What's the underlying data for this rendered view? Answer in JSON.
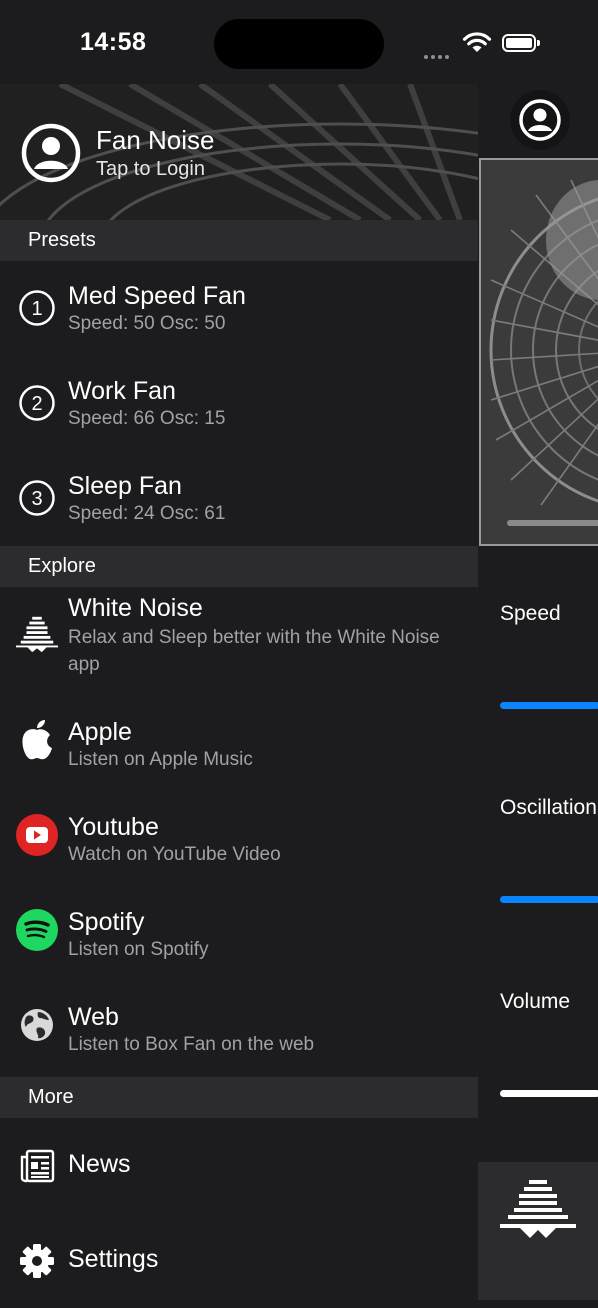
{
  "status": {
    "time": "14:58"
  },
  "header": {
    "title": "Fan Noise",
    "subtitle": "Tap to Login"
  },
  "sections": {
    "presets": "Presets",
    "explore": "Explore",
    "more": "More"
  },
  "presets": [
    {
      "number": "1",
      "title": "Med Speed Fan",
      "subtitle": "Speed: 50 Osc: 50"
    },
    {
      "number": "2",
      "title": "Work Fan",
      "subtitle": "Speed: 66 Osc: 15"
    },
    {
      "number": "3",
      "title": "Sleep Fan",
      "subtitle": "Speed: 24 Osc: 61"
    }
  ],
  "explore": [
    {
      "icon": "white-noise-icon",
      "title": "White Noise",
      "subtitle": "Relax and Sleep better with the White Noise app"
    },
    {
      "icon": "apple-icon",
      "title": "Apple",
      "subtitle": "Listen on Apple Music"
    },
    {
      "icon": "youtube-icon",
      "title": "Youtube",
      "subtitle": "Watch on YouTube Video"
    },
    {
      "icon": "spotify-icon",
      "title": "Spotify",
      "subtitle": "Listen on Spotify"
    },
    {
      "icon": "globe-icon",
      "title": "Web",
      "subtitle": "Listen to Box Fan on the web"
    }
  ],
  "more": [
    {
      "icon": "news-icon",
      "title": "News"
    },
    {
      "icon": "gear-icon",
      "title": "Settings"
    }
  ],
  "right_panel": {
    "speed_label": "Speed",
    "oscillation_label": "Oscillation",
    "volume_label": "Volume"
  },
  "colors": {
    "background": "#1c1c1e",
    "section": "#2c2c2e",
    "accent": "#0a84ff",
    "youtube": "#e02424",
    "spotify": "#1ed760"
  }
}
